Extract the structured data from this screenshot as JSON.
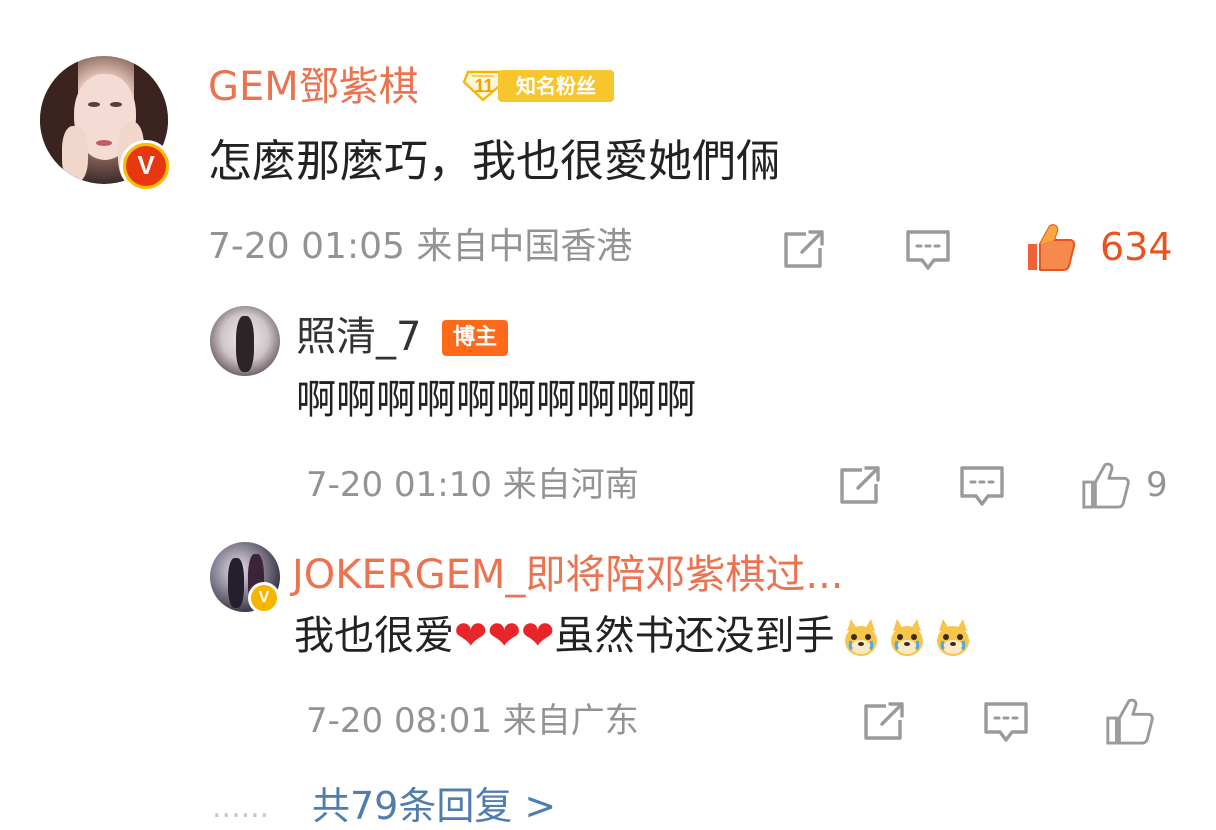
{
  "main_comment": {
    "username": "GEM鄧紫棋",
    "fan_badge": {
      "level": "11",
      "label": "知名粉丝"
    },
    "text": "怎麼那麼巧，我也很愛她們倆",
    "timestamp": "7-20 01:05 来自中国香港",
    "like_count": "634",
    "liked": true,
    "icons": [
      "share-icon",
      "comment-icon",
      "like-icon"
    ],
    "avatar_badge": "V"
  },
  "replies": [
    {
      "username": "照清_7",
      "role_badge": "博主",
      "text": "啊啊啊啊啊啊啊啊啊啊",
      "timestamp": "7-20 01:10 来自河南",
      "like_count": "9",
      "liked": false
    },
    {
      "username": "JOKERGEM_即将陪邓紫棋过...",
      "text_prefix": "我也很爱",
      "hearts": [
        "❤",
        "❤",
        "❤"
      ],
      "text_suffix": "虽然书还没到手",
      "emoji": [
        "doge-cry-emoji",
        "doge-cry-emoji",
        "doge-cry-emoji"
      ],
      "timestamp": "7-20 08:01 来自广东",
      "like_count": "",
      "liked": false,
      "avatar_badge": "V"
    }
  ],
  "more_replies": {
    "dots": "......",
    "label": "共79条回复 >"
  },
  "colors": {
    "username": "#eb7350",
    "liked": "#e8541e",
    "meta": "#939393",
    "link": "#507daf",
    "heart": "#e8262a",
    "fan_badge": "#f7c52c",
    "blogger_badge": "#ff6a1a"
  }
}
